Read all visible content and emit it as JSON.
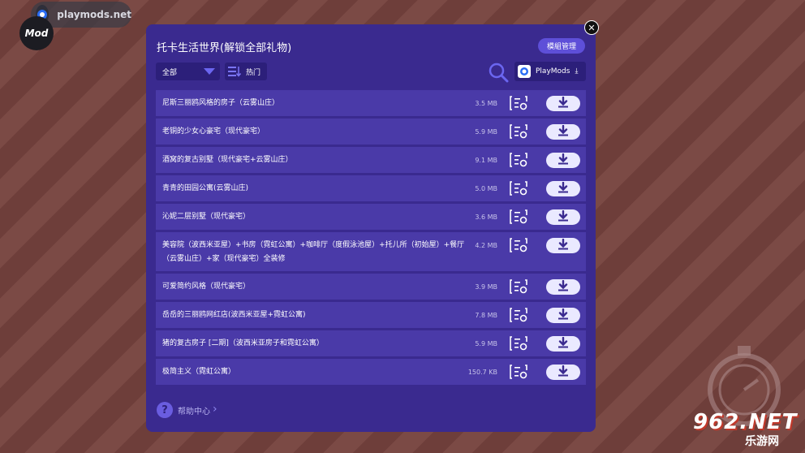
{
  "overlay": {
    "badge_text": "playmods.net",
    "mod_text": "Mod"
  },
  "panel": {
    "title": "托卡生活世界(解锁全部礼物)",
    "manage_label": "模組管理",
    "filter_value": "全部",
    "sort_label": "热门",
    "playmods_label": "PlayMods",
    "help_label": "帮助中心"
  },
  "items": [
    {
      "name": "尼斯三丽鸥风格的房子（云雾山庄）",
      "size": "3.5 MB"
    },
    {
      "name": "老铜的少女心豪宅（现代豪宅）",
      "size": "5.9 MB"
    },
    {
      "name": "酒窝的复古别墅（现代豪宅+云雾山庄）",
      "size": "9.1 MB"
    },
    {
      "name": "青青的田园公寓(云雾山庄)",
      "size": "5.0 MB"
    },
    {
      "name": "沁妮二层别墅（现代豪宅）",
      "size": "3.6 MB"
    },
    {
      "name": "美容院（波西米亚屋）+书房（霓虹公寓）+咖啡厅（度假泳池屋）+托儿所（初始屋）+餐厅（云雾山庄）+家（现代豪宅）全装修",
      "size": "4.2 MB"
    },
    {
      "name": "可爱简约风格（现代豪宅）",
      "size": "3.9 MB"
    },
    {
      "name": "岳岳的三丽鸥网红店(波西米亚屋+霓虹公寓)",
      "size": "7.8 MB"
    },
    {
      "name": "猪的复古房子 [二期]（波西米亚房子和霓虹公寓）",
      "size": "5.9 MB"
    },
    {
      "name": "极简主义（霓虹公寓）",
      "size": "150.7 KB"
    }
  ],
  "branding": {
    "number": "962",
    "net": ".NET",
    "sub": "乐游网"
  },
  "colors": {
    "panel": "#3a2a8f",
    "row": "#4a3aa8",
    "accent": "#6b66f0"
  }
}
